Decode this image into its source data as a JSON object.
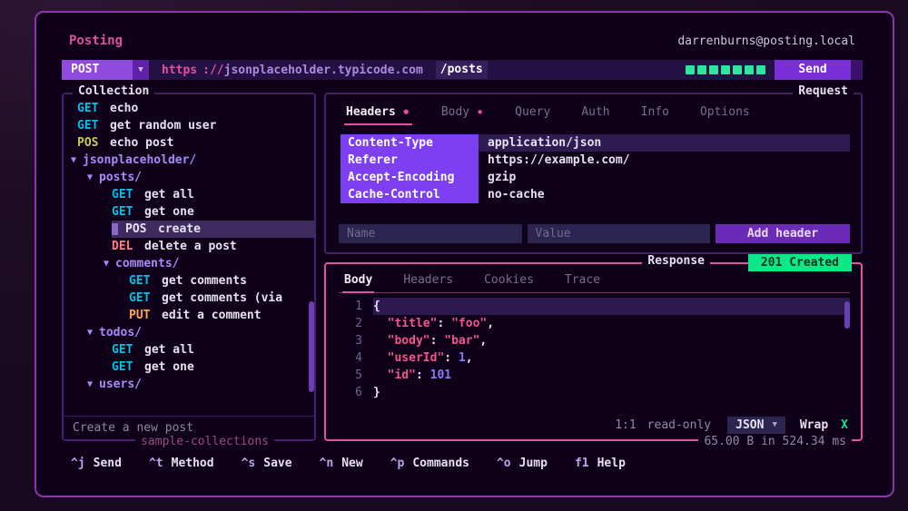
{
  "app": {
    "title": "Posting",
    "account": "darrenburns@posting.local"
  },
  "url_bar": {
    "method": "POST",
    "dropdown_icon": "▼",
    "scheme": "https",
    "separator": "://",
    "host": "jsonplaceholder.typicode.com",
    "path": "/posts",
    "trace_blocks": 7,
    "send_label": "Send"
  },
  "collection": {
    "title": "Collection",
    "subtitle": "sample-collections",
    "hint": "Create a new post",
    "folder_arrow": "▼",
    "items": [
      {
        "type": "request",
        "method": "GET",
        "label": "echo",
        "level": 0
      },
      {
        "type": "request",
        "method": "GET",
        "label": "get random user",
        "level": 0
      },
      {
        "type": "request",
        "method": "POS",
        "label": "echo post",
        "level": 0
      },
      {
        "type": "folder",
        "label": "jsonplaceholder/",
        "level": 0
      },
      {
        "type": "folder",
        "label": "posts/",
        "level": 1
      },
      {
        "type": "request",
        "method": "GET",
        "label": "get all",
        "level": 2
      },
      {
        "type": "request",
        "method": "GET",
        "label": "get one",
        "level": 2
      },
      {
        "type": "request",
        "method": "POS",
        "label": "create",
        "level": 2,
        "selected": true
      },
      {
        "type": "request",
        "method": "DEL",
        "label": "delete a post",
        "level": 2
      },
      {
        "type": "folder",
        "label": "comments/",
        "level": 2
      },
      {
        "type": "request",
        "method": "GET",
        "label": "get comments",
        "level": 3
      },
      {
        "type": "request",
        "method": "GET",
        "label": "get comments (via",
        "level": 3
      },
      {
        "type": "request",
        "method": "PUT",
        "label": "edit a comment",
        "level": 3
      },
      {
        "type": "folder",
        "label": "todos/",
        "level": 1
      },
      {
        "type": "request",
        "method": "GET",
        "label": "get all",
        "level": 2
      },
      {
        "type": "request",
        "method": "GET",
        "label": "get one",
        "level": 2
      },
      {
        "type": "folder",
        "label": "users/",
        "level": 1
      }
    ]
  },
  "request_panel": {
    "title": "Request",
    "tabs": [
      {
        "label": "Headers",
        "dot": true,
        "active": true
      },
      {
        "label": "Body",
        "dot": true,
        "active": false
      },
      {
        "label": "Query",
        "dot": false,
        "active": false
      },
      {
        "label": "Auth",
        "dot": false,
        "active": false
      },
      {
        "label": "Info",
        "dot": false,
        "active": false
      },
      {
        "label": "Options",
        "dot": false,
        "active": false
      }
    ],
    "headers": [
      {
        "name": "Content-Type",
        "value": "application/json",
        "selected": true
      },
      {
        "name": "Referer",
        "value": "https://example.com/"
      },
      {
        "name": "Accept-Encoding",
        "value": "gzip"
      },
      {
        "name": "Cache-Control",
        "value": "no-cache"
      }
    ],
    "name_placeholder": "Name",
    "value_placeholder": "Value",
    "add_header_label": "Add header"
  },
  "response_panel": {
    "title": "Response",
    "status_badge": "201 Created",
    "tabs": [
      {
        "label": "Body",
        "active": true
      },
      {
        "label": "Headers",
        "active": false
      },
      {
        "label": "Cookies",
        "active": false
      },
      {
        "label": "Trace",
        "active": false
      }
    ],
    "body_lines": [
      {
        "num": "1",
        "cursor": true,
        "tokens": [
          {
            "c": "p",
            "t": "{"
          }
        ]
      },
      {
        "num": "2",
        "tokens": [
          {
            "c": "w",
            "t": "  "
          },
          {
            "c": "k",
            "t": "\"title\""
          },
          {
            "c": "p",
            "t": ": "
          },
          {
            "c": "s",
            "t": "\"foo\""
          },
          {
            "c": "p",
            "t": ","
          }
        ]
      },
      {
        "num": "3",
        "tokens": [
          {
            "c": "w",
            "t": "  "
          },
          {
            "c": "k",
            "t": "\"body\""
          },
          {
            "c": "p",
            "t": ": "
          },
          {
            "c": "s",
            "t": "\"bar\""
          },
          {
            "c": "p",
            "t": ","
          }
        ]
      },
      {
        "num": "4",
        "tokens": [
          {
            "c": "w",
            "t": "  "
          },
          {
            "c": "k",
            "t": "\"userId\""
          },
          {
            "c": "p",
            "t": ": "
          },
          {
            "c": "n",
            "t": "1"
          },
          {
            "c": "p",
            "t": ","
          }
        ]
      },
      {
        "num": "5",
        "tokens": [
          {
            "c": "w",
            "t": "  "
          },
          {
            "c": "k",
            "t": "\"id\""
          },
          {
            "c": "p",
            "t": ": "
          },
          {
            "c": "n",
            "t": "101"
          }
        ]
      },
      {
        "num": "6",
        "tokens": [
          {
            "c": "p",
            "t": "}"
          }
        ]
      }
    ],
    "footer": {
      "cursor_position": "1:1",
      "mode": "read-only",
      "format": "JSON",
      "dropdown_icon": "▼",
      "wrap_label": "Wrap",
      "wrap_state": "X",
      "stats": "65.00 B in 524.34 ms"
    }
  },
  "footer": {
    "bindings": [
      {
        "key": "^j",
        "label": "Send"
      },
      {
        "key": "^t",
        "label": "Method"
      },
      {
        "key": "^s",
        "label": "Save"
      },
      {
        "key": "^n",
        "label": "New"
      },
      {
        "key": "^p",
        "label": "Commands"
      },
      {
        "key": "^o",
        "label": "Jump"
      },
      {
        "key": "f1",
        "label": "Help"
      }
    ]
  }
}
